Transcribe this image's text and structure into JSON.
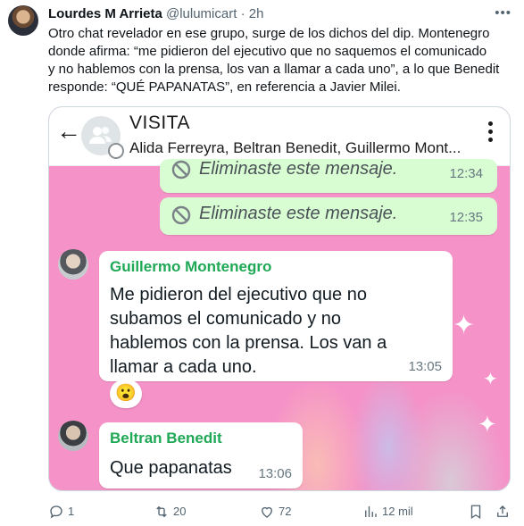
{
  "tweet": {
    "author_name": "Lourdes M Arrieta",
    "author_handle": "@lulumicart",
    "separator": "·",
    "time": "2h",
    "text_lines": [
      "Otro chat revelador en ese grupo, surge de los dichos del dip. Montenegro",
      "donde afirma: “me pidieron del ejecutivo que no saquemos el comunicado",
      "y no hablemos con la prensa, los van a llamar a cada uno”, a lo que Benedit",
      "responde: “QUÉ PAPANATAS”, en referencia a Javier Milei."
    ],
    "more_icon": "more-horizontal-icon"
  },
  "chat": {
    "title": "VISITA",
    "members": "Alida Ferreyra, Beltran Benedit, Guillermo Mont...",
    "deleted_messages": [
      {
        "text": "Eliminaste este mensaje.",
        "time": "12:34"
      },
      {
        "text": "Eliminaste este mensaje.",
        "time": "12:35"
      }
    ],
    "messages": [
      {
        "sender": "Guillermo Montenegro",
        "lines": [
          "Me pidieron del ejecutivo que no",
          "subamos el comunicado y no",
          "hablemos con la prensa. Los van a",
          "llamar a cada uno."
        ],
        "time": "13:05",
        "reaction": "😮"
      },
      {
        "sender": "Beltran Benedit",
        "lines": [
          "Que papanatas"
        ],
        "time": "13:06"
      }
    ],
    "colors": {
      "wallpaper": "#f592c8",
      "own_bubble": "#d9fdd3",
      "sender_name": "#1fa855"
    }
  },
  "actions": {
    "replies": "1",
    "retweets": "20",
    "likes": "72",
    "views": "12 mil"
  }
}
